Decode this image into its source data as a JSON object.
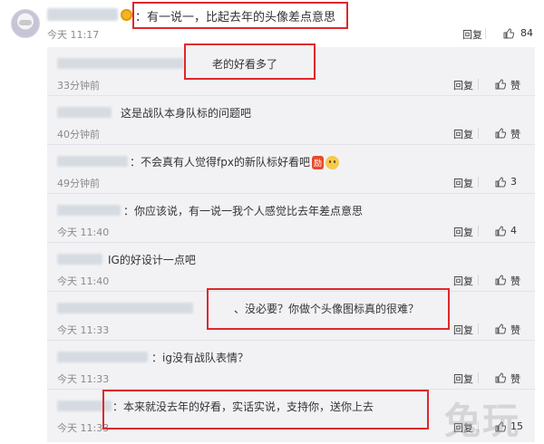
{
  "top": {
    "text": "：有一说一，比起去年的头像差点意思",
    "timestamp": "今天 11:17",
    "reply_label": "回复",
    "like_count": "84"
  },
  "replies": [
    {
      "text": "老的好看多了",
      "time": "33分钟前",
      "reply_label": "回复",
      "like_label": "赞"
    },
    {
      "text": "这是战队本身队标的问题吧",
      "time": "40分钟前",
      "reply_label": "回复",
      "like_label": "赞"
    },
    {
      "text": "：不会真有人觉得fpx的新队标好看吧",
      "emoji_li": "励",
      "time": "49分钟前",
      "reply_label": "回复",
      "like_label": "3"
    },
    {
      "text": "：你应该说，有一说一我个人感觉比去年差点意思",
      "time": "今天 11:40",
      "reply_label": "回复",
      "like_label": "4"
    },
    {
      "text": "IG的好设计一点吧",
      "time": "今天 11:40",
      "reply_label": "回复",
      "like_label": "赞"
    },
    {
      "text": "、没必要？你做个头像图标真的很难？",
      "time": "今天 11:33",
      "reply_label": "回复",
      "like_label": "赞"
    },
    {
      "text": "：ig没有战队表情？",
      "time": "今天 11:33",
      "reply_label": "回复",
      "like_label": "赞"
    },
    {
      "text": "：本来就没去年的好看，实话实说，支持你，送你上去",
      "time": "今天 11:33",
      "reply_label": "回复",
      "like_label": "15"
    }
  ],
  "watermark": "兔玩",
  "colors": {
    "highlight": "#e0272d",
    "reply_bg": "#f2f2f5"
  }
}
